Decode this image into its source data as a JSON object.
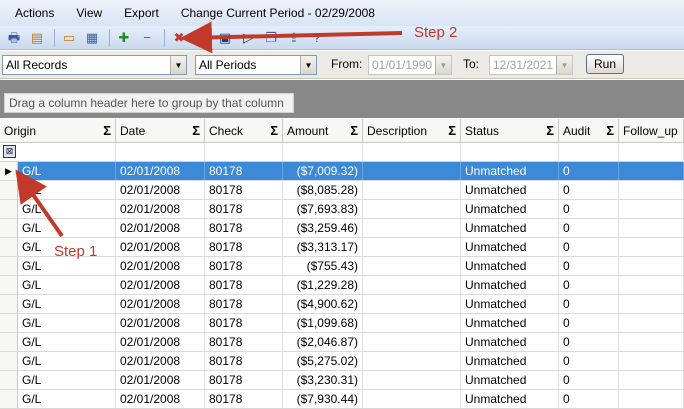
{
  "menu": {
    "items": [
      "Actions",
      "View",
      "Export"
    ],
    "period_label": "Change Current Period - 02/29/2008"
  },
  "toolbar": {
    "buttons": [
      {
        "icon": "print-icon",
        "glyph": "🖶",
        "color": "#3a5f9e"
      },
      {
        "icon": "preview-icon",
        "glyph": "▤",
        "color": "#c47a14"
      },
      {
        "icon": "panel-icon",
        "glyph": "▭",
        "color": "#c47a14"
      },
      {
        "icon": "grid-icon",
        "glyph": "▦",
        "color": "#3a5f9e"
      },
      {
        "icon": "add-record-icon",
        "glyph": "✚",
        "color": "#1f8a2c"
      },
      {
        "icon": "remove-record-icon",
        "glyph": "−",
        "color": "#c0392b"
      },
      {
        "icon": "delete-icon",
        "glyph": "✖",
        "color": "#c0392b"
      },
      {
        "icon": "edit-icon",
        "glyph": "✎",
        "color": "#3a5f9e"
      },
      {
        "icon": "save-icon",
        "glyph": "▣",
        "color": "#1a3f8a"
      },
      {
        "icon": "forward-icon",
        "glyph": "▷",
        "color": "#333"
      },
      {
        "icon": "copy-icon",
        "glyph": "❐",
        "color": "#3a5f9e"
      },
      {
        "icon": "export-icon",
        "glyph": "⇪",
        "color": "#1f8a2c"
      },
      {
        "icon": "help-icon",
        "glyph": "?",
        "color": "#1a4fb0"
      }
    ]
  },
  "filters": {
    "records": "All Records",
    "periods": "All Periods",
    "from_label": "From:",
    "from_value": "01/01/1990",
    "to_label": "To:",
    "to_value": "12/31/2021",
    "run_label": "Run"
  },
  "group_hint": "Drag a column header here to group by that column",
  "grid": {
    "columns": [
      "Origin",
      "Date",
      "Check",
      "Amount",
      "Description",
      "Status",
      "Audit",
      "Follow_up"
    ],
    "sigma": "Σ",
    "selected_row": 0,
    "rows": [
      [
        "G/L",
        "02/01/2008",
        "80178",
        "($7,009.32)",
        "",
        "Unmatched",
        "0",
        ""
      ],
      [
        "G/L",
        "02/01/2008",
        "80178",
        "($8,085.28)",
        "",
        "Unmatched",
        "0",
        ""
      ],
      [
        "G/L",
        "02/01/2008",
        "80178",
        "($7,693.83)",
        "",
        "Unmatched",
        "0",
        ""
      ],
      [
        "G/L",
        "02/01/2008",
        "80178",
        "($3,259.46)",
        "",
        "Unmatched",
        "0",
        ""
      ],
      [
        "G/L",
        "02/01/2008",
        "80178",
        "($3,313.17)",
        "",
        "Unmatched",
        "0",
        ""
      ],
      [
        "G/L",
        "02/01/2008",
        "80178",
        "($755.43)",
        "",
        "Unmatched",
        "0",
        ""
      ],
      [
        "G/L",
        "02/01/2008",
        "80178",
        "($1,229.28)",
        "",
        "Unmatched",
        "0",
        ""
      ],
      [
        "G/L",
        "02/01/2008",
        "80178",
        "($4,900.62)",
        "",
        "Unmatched",
        "0",
        ""
      ],
      [
        "G/L",
        "02/01/2008",
        "80178",
        "($1,099.68)",
        "",
        "Unmatched",
        "0",
        ""
      ],
      [
        "G/L",
        "02/01/2008",
        "80178",
        "($2,046.87)",
        "",
        "Unmatched",
        "0",
        ""
      ],
      [
        "G/L",
        "02/01/2008",
        "80178",
        "($5,275.02)",
        "",
        "Unmatched",
        "0",
        ""
      ],
      [
        "G/L",
        "02/01/2008",
        "80178",
        "($3,230.31)",
        "",
        "Unmatched",
        "0",
        ""
      ],
      [
        "G/L",
        "02/01/2008",
        "80178",
        "($7,930.44)",
        "",
        "Unmatched",
        "0",
        ""
      ]
    ]
  },
  "annotations": {
    "step1": "Step 1",
    "step2": "Step 2",
    "color": "#c0392b"
  }
}
